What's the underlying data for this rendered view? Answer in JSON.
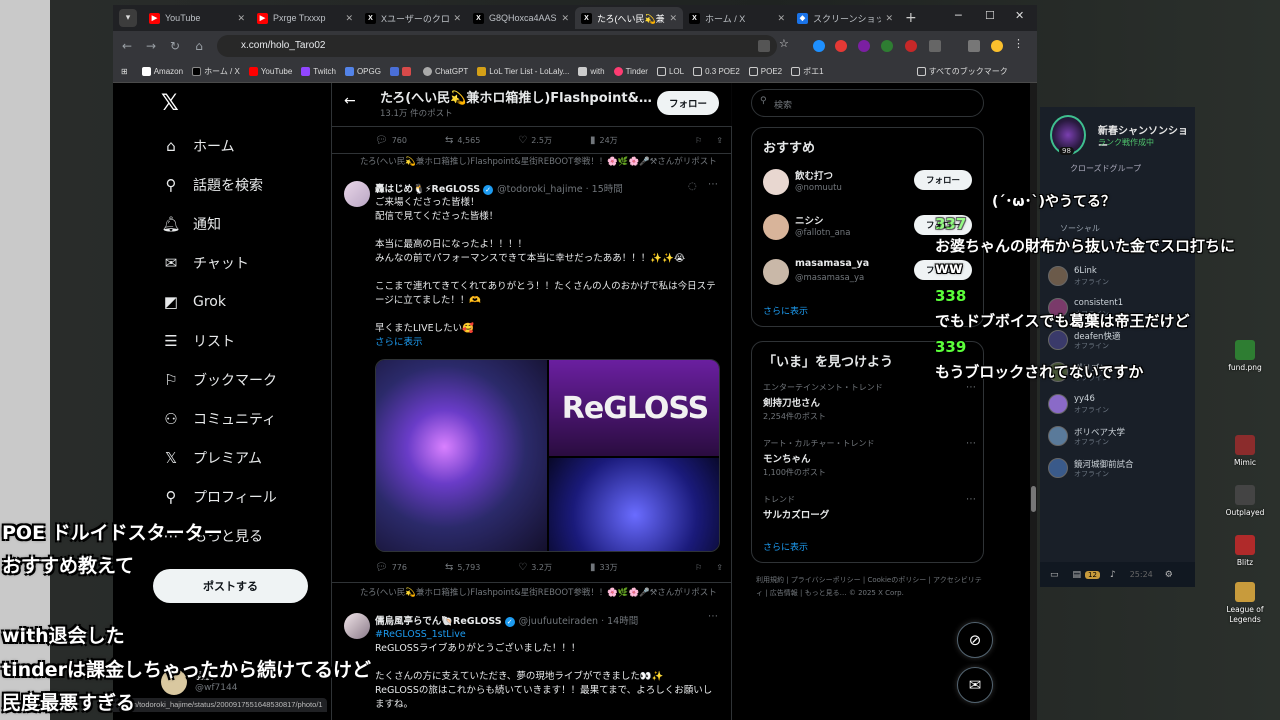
{
  "tabs": [
    {
      "title": "YouTube",
      "color": "#ff0000",
      "glyph": "▶"
    },
    {
      "title": "Pxrge Trxxxp",
      "color": "#ff0000",
      "glyph": "▶"
    },
    {
      "title": "Xユーザーのクロ@",
      "color": "#000000",
      "glyph": "X"
    },
    {
      "title": "G8QHoxca4AAS",
      "color": "#000000",
      "glyph": "X"
    },
    {
      "title": "たろ(へい民💫兼...",
      "color": "#000000",
      "glyph": "X"
    },
    {
      "title": "ホーム / X",
      "color": "#000000",
      "glyph": "X"
    },
    {
      "title": "スクリーンショット",
      "color": "#1a73e8",
      "glyph": "◆"
    }
  ],
  "address": {
    "url": "x.com/holo_Taro02"
  },
  "bookmarks": [
    "Amazon",
    "ホーム / X",
    "YouTube",
    "Twitch",
    "OPGG",
    "",
    "ChatGPT",
    "LoL Tier List - LoLaly...",
    "with",
    "Tinder",
    "LOL",
    "0.3 POE2",
    "POE2",
    "ポエ1",
    "すべてのブックマーク"
  ],
  "xnav": {
    "items": [
      "ホーム",
      "話題を検索",
      "通知",
      "チャット",
      "Grok",
      "リスト",
      "ブックマーク",
      "コミュニティ",
      "プレミアム",
      "プロフィール",
      "もっと見る"
    ],
    "post_label": "ポストする",
    "account_name": "羽波",
    "account_handle": "@wf7144"
  },
  "timeline": {
    "title": "たろ(へい民💫兼ホロ箱推し)Flashpoint&星...",
    "subtitle": "13.1万 件のポスト",
    "follow_label": "フォロー",
    "top_stats": {
      "reply": "760",
      "repost": "4,565",
      "like": "2.5万",
      "views": "24万"
    },
    "post1": {
      "repost_note": "たろ(へい民💫兼ホロ箱推し)Flashpoint&星街REBOOT参戦！！🌸🌿🌸🎤⚒さんがリポスト",
      "name": "轟はじめ🐧⚡ReGLOSS",
      "handle": "@todoroki_hajime · 15時間",
      "text": "ご来場くださった皆様！\n配信で見てくださった皆様！\n\n本当に最高の日になったよ！！！！\nみんなの前でパフォーマンスできて本当に幸せだったああ！！！✨✨😭\n\nここまで連れてきてくれてありがとう！！たくさんの人のおかげで私は今日ステージに立てました！！🫶\n\n早くまたLIVEしたい🥰",
      "show_more": "さらに表示",
      "media_text": "ReGLOSS",
      "stats": {
        "reply": "776",
        "repost": "5,793",
        "like": "3.2万",
        "views": "33万"
      }
    },
    "post2": {
      "repost_note": "たろ(へい民💫兼ホロ箱推し)Flashpoint&星街REBOOT参戦！！🌸🌿🌸🎤⚒さんがリポスト",
      "name": "儒烏風亭らでん🐚ReGLOSS",
      "handle": "@juufuuteiraden · 14時間",
      "hashtag": "#ReGLOSS_1stLive",
      "text": "ReGLOSSライブありがとうございました！！！\n\nたくさんの方に支えていただき、夢の現地ライブができました👀✨\nReGLOSSの旅はこれからも続いていきます！！最果てまで、よろしくお願いしますね。"
    }
  },
  "right": {
    "search_placeholder": "検索",
    "recommend_title": "おすすめ",
    "recommend": [
      {
        "name": "飲む打つ",
        "handle": "@nomuutu",
        "follow": "フォロー"
      },
      {
        "name": "ニシシ",
        "handle": "@fallotn_ana",
        "follow": "フォロー"
      },
      {
        "name": "masamasa_ya",
        "handle": "@masamasa_ya",
        "follow": "フォロー"
      }
    ],
    "show_more": "さらに表示",
    "trends_title": "「いま」を見つけよう",
    "trends": [
      {
        "cat": "エンターテインメント・トレンド",
        "name": "剣持刀也さん",
        "count": "2,254件のポスト"
      },
      {
        "cat": "アート・カルチャー・トレンド",
        "name": "モンちゃん",
        "count": "1,100件のポスト"
      },
      {
        "cat": "トレンド",
        "name": "サルカズローグ",
        "count": ""
      }
    ],
    "trends_more": "さらに表示",
    "footer": "利用規約 | プライバシーポリシー | Cookieのポリシー | アクセシビリティ | 広告情報 | もっと見る… © 2025 X Corp."
  },
  "steam": {
    "name": "新春シャンソンショー",
    "status": "ランク戦作成中",
    "level": "98",
    "group": "クローズドグループ",
    "social": "ソーシャル",
    "friends": [
      {
        "name": "6Link",
        "status": "オフライン"
      },
      {
        "name": "consistent1",
        "status": "オフライン"
      },
      {
        "name": "deafen快適",
        "status": "オフライン"
      },
      {
        "name": "ポリゴン",
        "status": "オフライン"
      },
      {
        "name": "yy46",
        "status": "オフライン"
      },
      {
        "name": "ボリベア大学",
        "status": "オフライン"
      },
      {
        "name": "鏡河城御前試合",
        "status": "オフライン"
      }
    ],
    "bar_badge": "12",
    "bar_time": "25:24"
  },
  "desktop_icons": [
    {
      "label": "fund.png",
      "color": "#4caf50"
    },
    {
      "label": "Mimic",
      "color": "#a03a3a"
    },
    {
      "label": "Outplayed",
      "color": "#555555"
    },
    {
      "label": "Blitz",
      "color": "#c0392b"
    },
    {
      "label": "League of Legends",
      "color": "#c89b3c"
    }
  ],
  "chat": {
    "face": "(´･ω･`)やうてる？",
    "n1": "337",
    "line1": "お婆ちゃんの財布から抜いた金でスロ打ちに",
    "line1b": "ww",
    "n2": "338",
    "line2": "でもドブボイスでも葛葉は帝王だけど",
    "n3": "339",
    "line3": "もうブロックされてないですか"
  },
  "captions": {
    "c1": "POE ドルイドスターター",
    "c2": "おすすめ教えて",
    "c3": "with退会した",
    "c4": "tinderは課金しちゃったから続けてるけど",
    "c5": "民度最悪すぎる"
  },
  "status_url": "x.com/todoroki_hajime/status/2000917551648530817/photo/1"
}
